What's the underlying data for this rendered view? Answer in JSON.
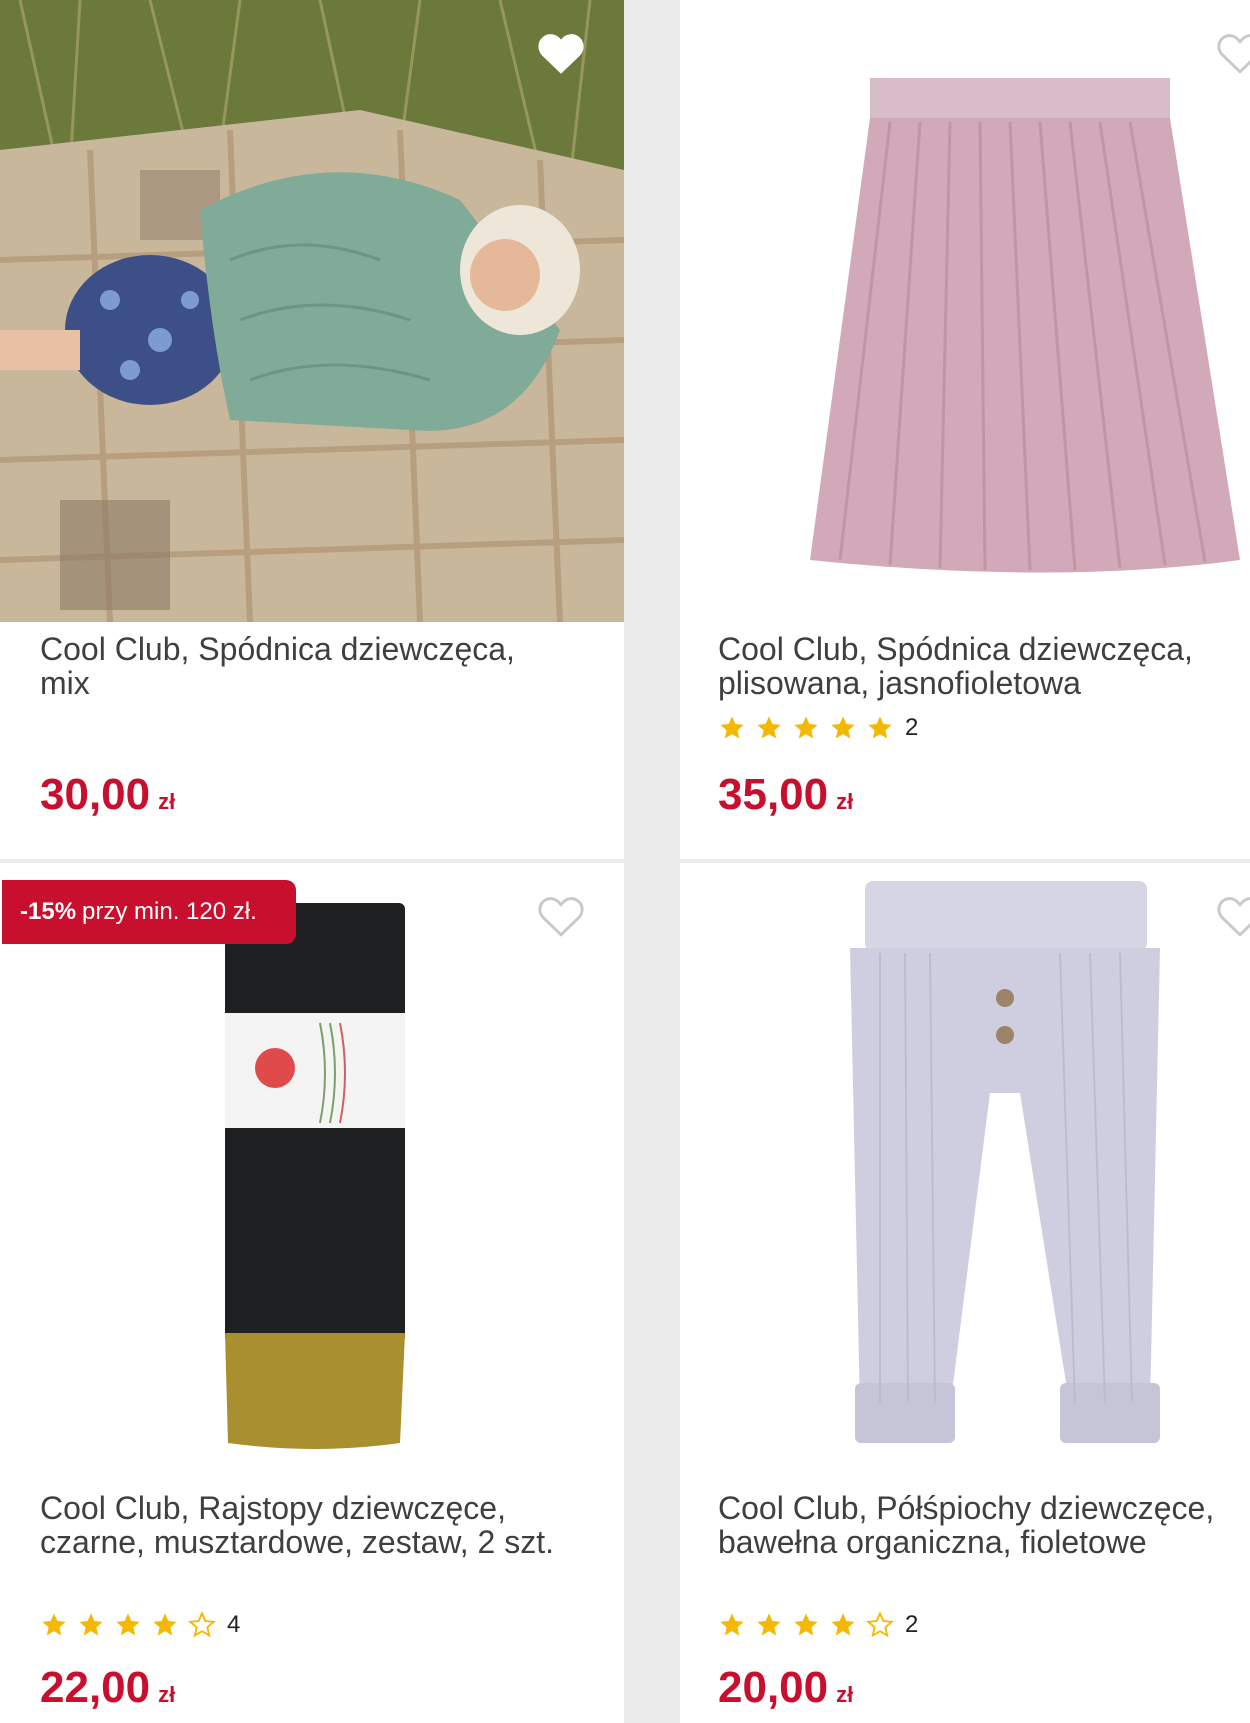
{
  "products": [
    {
      "title": "Cool Club, Spódnica dziewczęca, mix",
      "price": "30,00",
      "currency": "zł",
      "favorite_icon": "heart-outline-icon",
      "image": "girl-lying-on-blanket-photo"
    },
    {
      "title": "Cool Club, Spódnica dziewczęca, plisowana, jasnofioletowa",
      "rating": 5,
      "rating_count": "2",
      "price": "35,00",
      "currency": "zł",
      "favorite_icon": "heart-outline-icon",
      "image": "pink-pleated-skirt-photo"
    },
    {
      "promo_discount": "-15%",
      "promo_text": "przy min. 120 zł.",
      "title": "Cool Club, Rajstopy dziewczęce, czarne, musztardowe, zestaw, 2 szt.",
      "rating": 4,
      "rating_count": "4",
      "price": "22,00",
      "currency": "zł",
      "favorite_icon": "heart-outline-icon",
      "image": "black-mustard-tights-photo"
    },
    {
      "title": "Cool Club, Półśpiochy dziewczęce, bawełna organiczna, fioletowe",
      "rating": 4,
      "rating_count": "2",
      "price": "20,00",
      "currency": "zł",
      "favorite_icon": "heart-outline-icon",
      "image": "lilac-ribbed-pants-photo"
    }
  ],
  "colors": {
    "price": "#c8102e",
    "star": "#f5b800",
    "promo_bg": "#c8102e"
  }
}
